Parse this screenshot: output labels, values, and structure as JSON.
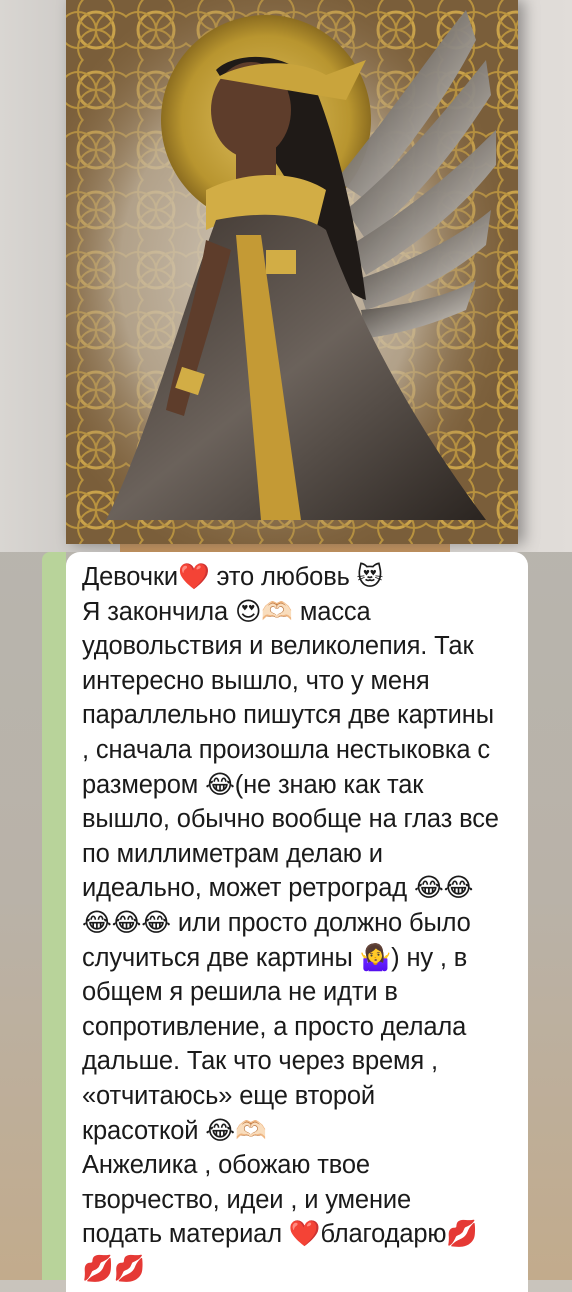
{
  "photo": {
    "alt": "Painting of a winged woman with a golden halo on an easel"
  },
  "message": {
    "lines": [
      "Девочки❤️ это любовь 😻",
      "Я закончила 😍🫶🏻 масса",
      "удовольствия и великолепия. Так",
      "интересно вышло, что у меня",
      "параллельно пишутся две картины",
      ", сначала произошла нестыковка с",
      "размером 😂(не знаю как так",
      "вышло, обычно вообще на глаз все",
      "по миллиметрам делаю и",
      "идеально, может ретроград 😂😂",
      "😂😂😂 или просто должно было",
      "случиться две картины 🤷‍♀️) ну , в",
      "общем я решила не идти в",
      "сопротивление, а просто делала",
      "дальше. Так что через время ,",
      "«отчитаюсь» еще второй",
      "красоткой 😂🫶🏻",
      "Анжелика , обожаю твое",
      "творчество, идеи , и умение",
      "подать материал ❤️благодарю💋",
      "💋💋"
    ]
  }
}
